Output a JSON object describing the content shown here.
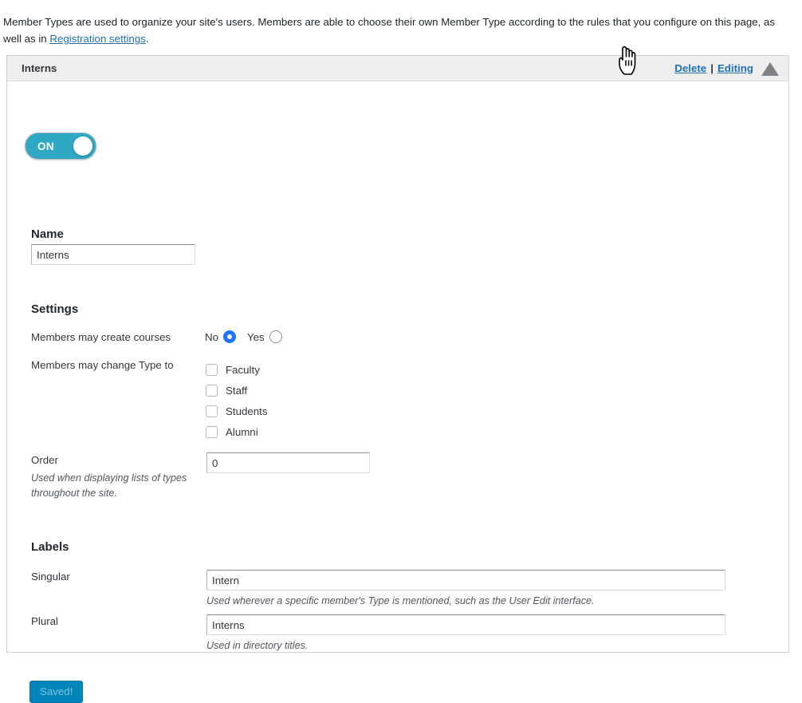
{
  "intro": {
    "text_before_link": "Member Types are used to organize your site's users. Members are able to choose their own Member Type according to the rules that you configure on this page, as well as in ",
    "link_text": "Registration settings",
    "text_after_link": "."
  },
  "panel": {
    "title": "Interns",
    "actions": {
      "delete_label": "Delete",
      "separator": "|",
      "editing_label": "Editing"
    },
    "collapse_icon": "triangle-up-icon"
  },
  "toggle": {
    "state_label": "ON",
    "enabled": true,
    "color": "#2fa8c4"
  },
  "name": {
    "label": "Name",
    "value": "Interns"
  },
  "settings": {
    "heading": "Settings",
    "create_courses": {
      "label": "Members may create courses",
      "options": [
        "No",
        "Yes"
      ],
      "selected": "No"
    },
    "change_type": {
      "label": "Members may change Type to",
      "options": [
        {
          "label": "Faculty",
          "checked": false
        },
        {
          "label": "Staff",
          "checked": false
        },
        {
          "label": "Students",
          "checked": false
        },
        {
          "label": "Alumni",
          "checked": false
        }
      ]
    },
    "order": {
      "label": "Order",
      "help": "Used when displaying lists of types throughout the site.",
      "value": "0"
    }
  },
  "labels": {
    "heading": "Labels",
    "singular": {
      "label": "Singular",
      "value": "Intern",
      "help": "Used wherever a specific member's Type is mentioned, such as the User Edit interface."
    },
    "plural": {
      "label": "Plural",
      "value": "Interns",
      "help": "Used in directory titles."
    }
  },
  "save": {
    "label": "Saved!",
    "color": "#0085ba"
  },
  "cursor": {
    "icon": "pointing-hand-cursor"
  }
}
